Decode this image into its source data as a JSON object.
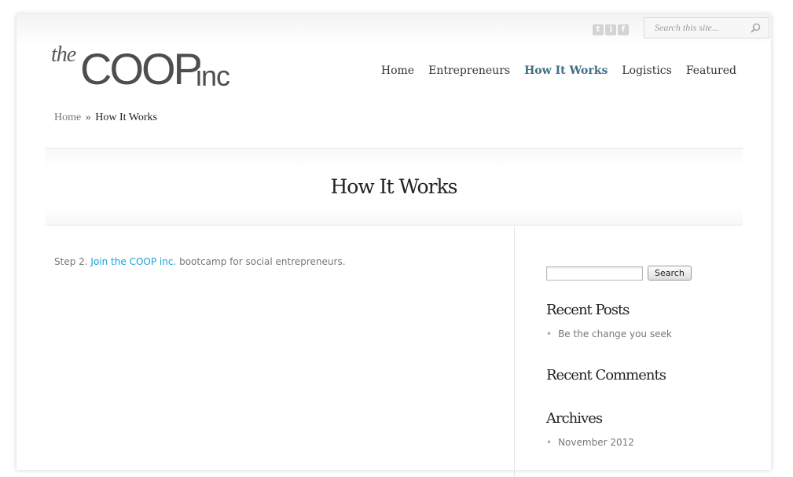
{
  "header": {
    "logo_the": "the",
    "logo_coop": "COOP",
    "logo_inc": "inc",
    "social_icons": [
      "twitter-icon",
      "rss-icon",
      "facebook-icon"
    ],
    "search_placeholder": "Search this site..."
  },
  "nav": {
    "items": [
      {
        "label": "Home",
        "active": false
      },
      {
        "label": "Entrepreneurs",
        "active": false
      },
      {
        "label": "How It Works",
        "active": true
      },
      {
        "label": "Logistics",
        "active": false
      },
      {
        "label": "Featured",
        "active": false
      }
    ]
  },
  "breadcrumb": {
    "home": "Home",
    "separator": "»",
    "current": "How It Works"
  },
  "page": {
    "title": "How It Works"
  },
  "content": {
    "prefix": "Step 2.",
    "link_text": "Join the COOP inc.",
    "suffix": "bootcamp for social entrepreneurs."
  },
  "sidebar": {
    "search_button": "Search",
    "recent_posts_title": "Recent Posts",
    "recent_posts": [
      "Be the change you seek"
    ],
    "recent_comments_title": "Recent Comments",
    "archives_title": "Archives",
    "archives": [
      "November 2012"
    ]
  },
  "colors": {
    "active_nav": "#3e6f86",
    "link": "#1da1d6"
  }
}
